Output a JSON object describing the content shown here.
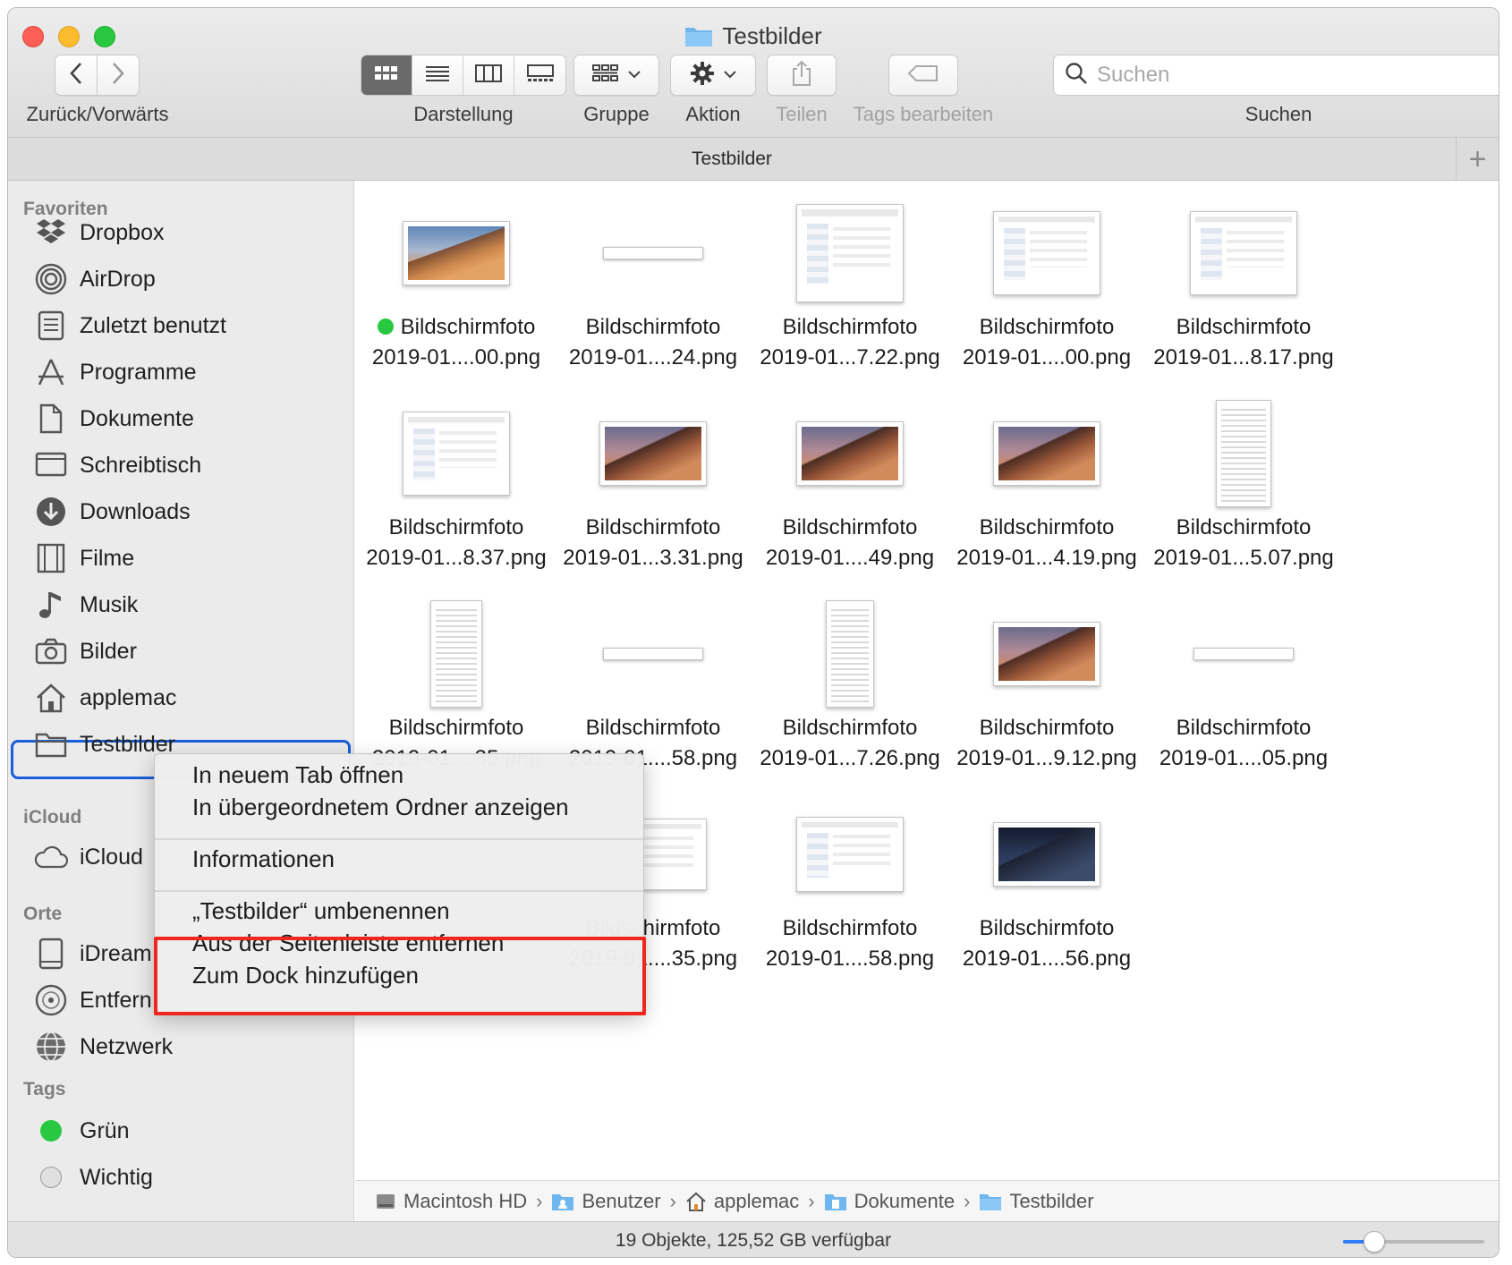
{
  "window": {
    "title": "Testbilder"
  },
  "toolbar": {
    "back_forward_label": "Zurück/Vorwärts",
    "view_label": "Darstellung",
    "group_label": "Gruppe",
    "action_label": "Aktion",
    "share_label": "Teilen",
    "tags_label": "Tags bearbeiten",
    "search_label": "Suchen",
    "search_placeholder": "Suchen"
  },
  "tabbar": {
    "title": "Testbilder",
    "add": "+"
  },
  "sidebar": {
    "favorites_header": "Favoriten",
    "favorites": [
      {
        "label": "Dropbox",
        "icon": "dropbox-icon"
      },
      {
        "label": "AirDrop",
        "icon": "airdrop-icon"
      },
      {
        "label": "Zuletzt benutzt",
        "icon": "recents-icon"
      },
      {
        "label": "Programme",
        "icon": "applications-icon"
      },
      {
        "label": "Dokumente",
        "icon": "documents-icon"
      },
      {
        "label": "Schreibtisch",
        "icon": "desktop-icon"
      },
      {
        "label": "Downloads",
        "icon": "downloads-icon"
      },
      {
        "label": "Filme",
        "icon": "movies-icon"
      },
      {
        "label": "Musik",
        "icon": "music-icon"
      },
      {
        "label": "Bilder",
        "icon": "pictures-icon"
      },
      {
        "label": "applemac",
        "icon": "home-icon"
      },
      {
        "label": "Testbilder",
        "icon": "folder-icon"
      }
    ],
    "icloud_header": "iCloud",
    "icloud_item": "iCloud",
    "places_header": "Orte",
    "places": [
      {
        "label": "iDream",
        "icon": "drive-icon"
      },
      {
        "label": "Entfern",
        "icon": "disc-icon"
      },
      {
        "label": "Netzwerk",
        "icon": "network-icon"
      }
    ],
    "tags_header": "Tags",
    "tags": [
      {
        "label": "Grün",
        "color": "#28c840"
      },
      {
        "label": "Wichtig",
        "color": "#d8d8d8"
      }
    ]
  },
  "files": [
    {
      "line1": "Bildschirmfoto",
      "line2": "2019-01....00.png",
      "kind": "desert",
      "tag": "#28c840"
    },
    {
      "line1": "Bildschirmfoto",
      "line2": "2019-01....24.png",
      "kind": "line"
    },
    {
      "line1": "Bildschirmfoto",
      "line2": "2019-01...7.22.png",
      "kind": "ui-square"
    },
    {
      "line1": "Bildschirmfoto",
      "line2": "2019-01....00.png",
      "kind": "ui-square"
    },
    {
      "line1": "Bildschirmfoto",
      "line2": "2019-01...8.17.png",
      "kind": "ui-square"
    },
    {
      "line1": "Bildschirmfoto",
      "line2": "2019-01...8.37.png",
      "kind": "ui-square"
    },
    {
      "line1": "Bildschirmfoto",
      "line2": "2019-01...3.31.png",
      "kind": "desert-eve"
    },
    {
      "line1": "Bildschirmfoto",
      "line2": "2019-01....49.png",
      "kind": "desert-eve"
    },
    {
      "line1": "Bildschirmfoto",
      "line2": "2019-01...4.19.png",
      "kind": "desert-eve"
    },
    {
      "line1": "Bildschirmfoto",
      "line2": "2019-01...5.07.png",
      "kind": "tall"
    },
    {
      "line1": "Bildschirmfoto",
      "line2": "2019-01....35.png",
      "kind": "tall"
    },
    {
      "line1": "Bildschirmfoto",
      "line2": "2019-01....58.png",
      "kind": "line"
    },
    {
      "line1": "Bildschirmfoto",
      "line2": "2019-01...7.26.png",
      "kind": "tall"
    },
    {
      "line1": "Bildschirmfoto",
      "line2": "2019-01...9.12.png",
      "kind": "desert-eve"
    },
    {
      "line1": "Bildschirmfoto",
      "line2": "2019-01....05.png",
      "kind": "line"
    },
    {
      "line1": "Bildschirmfoto",
      "line2": "2019-01....35.png",
      "kind": "ui-wide"
    },
    {
      "line1": "Bildschirmfoto",
      "line2": "2019-01....58.png",
      "kind": "ui-wide"
    },
    {
      "line1": "Bildschirmfoto",
      "line2": "2019-01....56.png",
      "kind": "desert-night"
    }
  ],
  "context_menu": {
    "items": [
      "In neuem Tab öffnen",
      "In übergeordnetem Ordner anzeigen",
      "Informationen",
      "„Testbilder“ umbenennen",
      "Aus der Seitenleiste entfernen",
      "Zum Dock hinzufügen"
    ],
    "highlight_color": "#f0271f"
  },
  "pathbar": [
    {
      "label": "Macintosh HD",
      "icon": "hard-drive-icon"
    },
    {
      "label": "Benutzer",
      "icon": "users-folder-icon"
    },
    {
      "label": "applemac",
      "icon": "home-icon"
    },
    {
      "label": "Dokumente",
      "icon": "documents-folder-icon"
    },
    {
      "label": "Testbilder",
      "icon": "folder-icon"
    }
  ],
  "status": {
    "text": "19 Objekte, 125,52 GB verfügbar",
    "icon_size_fraction": 0.22
  }
}
